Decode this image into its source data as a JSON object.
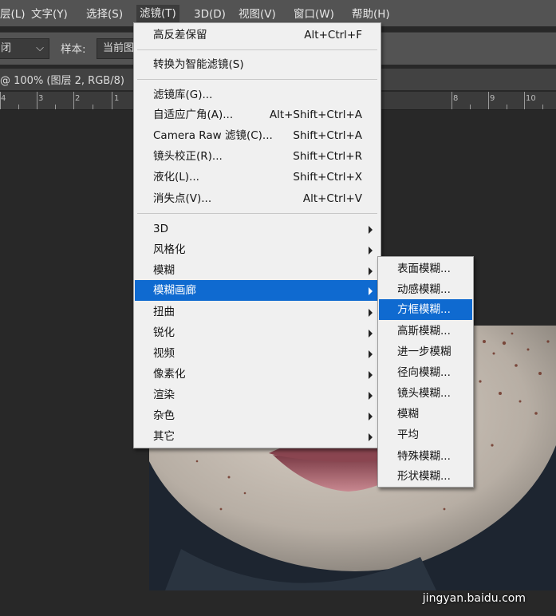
{
  "menubar": {
    "items": [
      {
        "label": "层(L)"
      },
      {
        "label": "文字(Y)"
      },
      {
        "label": "选择(S)"
      },
      {
        "label": "滤镜(T)"
      },
      {
        "label": "3D(D)"
      },
      {
        "label": "视图(V)"
      },
      {
        "label": "窗口(W)"
      },
      {
        "label": "帮助(H)"
      }
    ]
  },
  "options": {
    "left_select": "闭",
    "sample_label": "样本:",
    "sample_value": "当前图"
  },
  "doctab": {
    "title": "@ 100% (图层 2, RGB/8)"
  },
  "ruler": {
    "labels": [
      "4",
      "3",
      "2",
      "1",
      "8",
      "9",
      "10"
    ]
  },
  "filter_menu": {
    "items": [
      {
        "label": "高反差保留",
        "shortcut": "Alt+Ctrl+F"
      },
      {
        "label": "转换为智能滤镜(S)",
        "shortcut": ""
      },
      {
        "label": "滤镜库(G)...",
        "shortcut": ""
      },
      {
        "label": "自适应广角(A)...",
        "shortcut": "Alt+Shift+Ctrl+A"
      },
      {
        "label": "Camera Raw 滤镜(C)...",
        "shortcut": "Shift+Ctrl+A"
      },
      {
        "label": "镜头校正(R)...",
        "shortcut": "Shift+Ctrl+R"
      },
      {
        "label": "液化(L)...",
        "shortcut": "Shift+Ctrl+X"
      },
      {
        "label": "消失点(V)...",
        "shortcut": "Alt+Ctrl+V"
      },
      {
        "label": "3D"
      },
      {
        "label": "风格化"
      },
      {
        "label": "模糊"
      },
      {
        "label": "模糊画廊"
      },
      {
        "label": "扭曲"
      },
      {
        "label": "锐化"
      },
      {
        "label": "视频"
      },
      {
        "label": "像素化"
      },
      {
        "label": "渲染"
      },
      {
        "label": "杂色"
      },
      {
        "label": "其它"
      }
    ]
  },
  "blur_submenu": {
    "items": [
      {
        "label": "表面模糊..."
      },
      {
        "label": "动感模糊..."
      },
      {
        "label": "方框模糊..."
      },
      {
        "label": "高斯模糊..."
      },
      {
        "label": "进一步模糊"
      },
      {
        "label": "径向模糊..."
      },
      {
        "label": "镜头模糊..."
      },
      {
        "label": "模糊"
      },
      {
        "label": "平均"
      },
      {
        "label": "特殊模糊..."
      },
      {
        "label": "形状模糊..."
      }
    ]
  },
  "watermark": {
    "text": "jingyan.baidu.com"
  },
  "colors": {
    "highlight": "#0f6ad0",
    "menu_bg": "#f0f0f0",
    "app_bg": "#282828",
    "bar_bg": "#535353"
  }
}
